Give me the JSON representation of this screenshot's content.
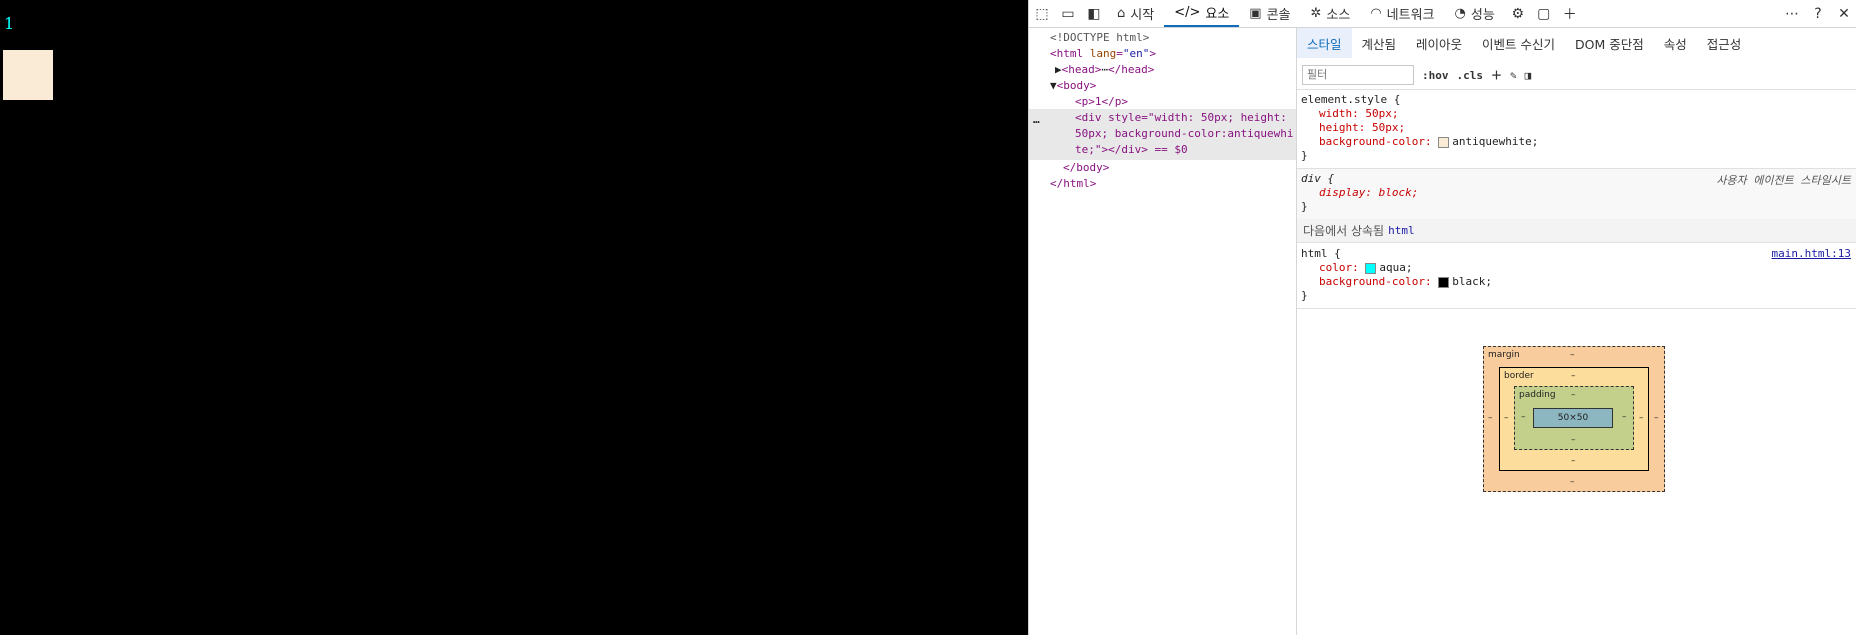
{
  "page": {
    "paragraph_text": "1",
    "box_color": "#faebd7",
    "text_color": "#00ffff",
    "background": "#000000"
  },
  "toolbar": {
    "icons": [
      "inspect-icon",
      "device-emulation-icon",
      "dock-panel-icon"
    ],
    "tabs": [
      {
        "label": "시작",
        "icon": "home-icon"
      },
      {
        "label": "요소",
        "icon": "code-icon",
        "active": true
      },
      {
        "label": "콘솔",
        "icon": "console-icon"
      },
      {
        "label": "소스",
        "icon": "bug-icon"
      },
      {
        "label": "네트워크",
        "icon": "wifi-icon"
      },
      {
        "label": "성능",
        "icon": "gauge-icon"
      }
    ],
    "right_icons": [
      "settings-icon",
      "panel-icon",
      "plus-icon",
      "more-icon",
      "help-icon",
      "close-icon"
    ],
    "accent": "#0f6cbd"
  },
  "elements": {
    "doctype": "<!DOCTYPE html>",
    "html_open": "<html",
    "html_attr": "lang",
    "html_val": "\"en\"",
    "head": "<head>",
    "head_close": "</head>",
    "body_open": "<body>",
    "p_line": "<p>1</p>",
    "div_line1": "<div style=\"width: 50px; height:",
    "div_line2": "50px; background-color:antiquewhi",
    "div_line3": "te;\"></div> == $0",
    "body_close": "</body>",
    "html_close": "</html>",
    "ellipsis": "…",
    "more": "⋯"
  },
  "styles": {
    "subtabs": [
      {
        "label": "스타일",
        "active": true
      },
      {
        "label": "계산됨"
      },
      {
        "label": "레이아웃"
      },
      {
        "label": "이벤트 수신기"
      },
      {
        "label": "DOM 중단점"
      },
      {
        "label": "속성"
      },
      {
        "label": "접근성"
      }
    ],
    "filter_placeholder": "필터",
    "hov": ":hov",
    "cls": ".cls",
    "element_style": {
      "selector": "element.style {",
      "p1": "width: 50px;",
      "p2": "height: 50px;",
      "p3_name": "background-color: ",
      "p3_val": "antiquewhite;",
      "close": "}"
    },
    "div_rule": {
      "selector": "div {",
      "p1": "display: block;",
      "close": "}",
      "source": "사용자 에이전트 스타일시트"
    },
    "inherited_label": "다음에서 상속됨",
    "inherited_from": "html",
    "html_rule": {
      "selector": "html {",
      "p1_name": "color: ",
      "p1_val": "aqua;",
      "p2_name": "background-color: ",
      "p2_val": "black;",
      "close": "}",
      "source": "main.html:13"
    }
  },
  "boxmodel": {
    "margin": "margin",
    "border": "border",
    "padding": "padding",
    "content": "50×50",
    "dash": "–"
  }
}
